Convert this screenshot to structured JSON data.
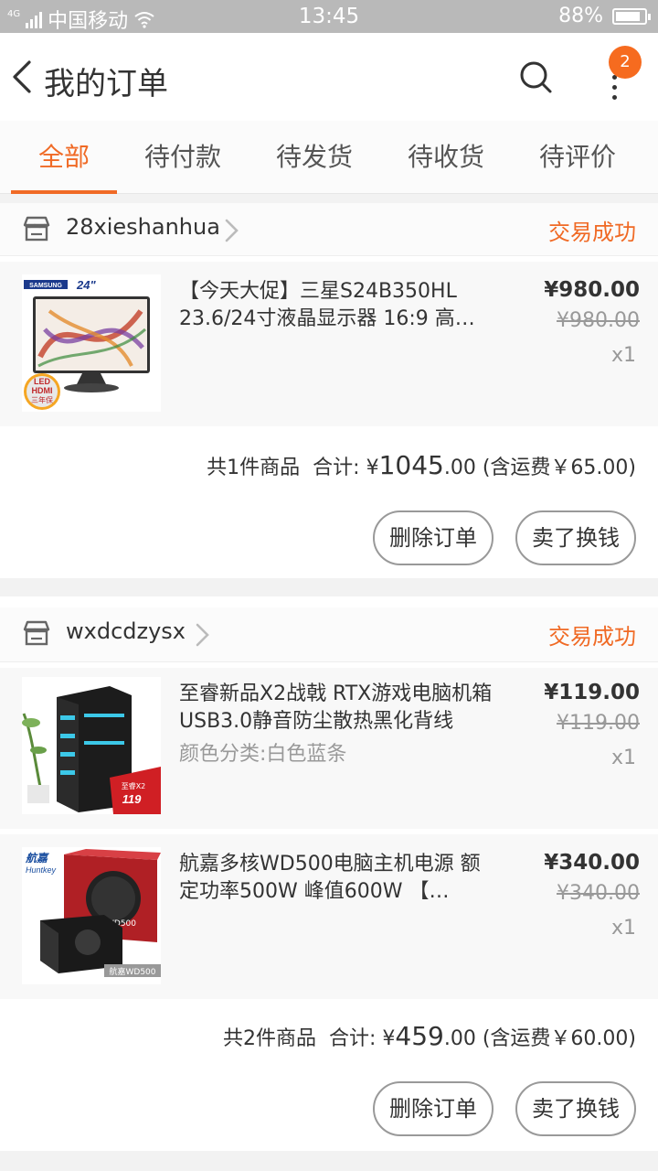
{
  "status_bar": {
    "network": "4G",
    "carrier": "中国移动",
    "time": "13:45",
    "battery": "88%",
    "battery_level": 0.88
  },
  "header": {
    "title": "我的订单",
    "badge_count": "2"
  },
  "tabs": [
    {
      "label": "全部",
      "active": true
    },
    {
      "label": "待付款",
      "active": false
    },
    {
      "label": "待发货",
      "active": false
    },
    {
      "label": "待收货",
      "active": false
    },
    {
      "label": "待评价",
      "active": false
    }
  ],
  "orders": [
    {
      "shop": "28xieshanhua",
      "status": "交易成功",
      "items": [
        {
          "title": "【今天大促】三星S24B350HL 23.6/24寸液晶显示器 16:9 高…",
          "price": "¥980.00",
          "original_price": "¥980.00",
          "qty": "x1",
          "thumb_labels": [
            "SAMSUNG",
            "24\"",
            "LED",
            "HDMI",
            "三年保"
          ]
        }
      ],
      "summary": {
        "count": "共1件商品",
        "total_label": "合计:",
        "currency": "¥",
        "total_int": "1045",
        "total_dec": ".00",
        "shipping": "(含运费￥65.00)"
      },
      "buttons": {
        "delete": "删除订单",
        "resell": "卖了换钱"
      }
    },
    {
      "shop": "wxdcdzysx",
      "status": "交易成功",
      "items": [
        {
          "title": "至睿新品X2战戟 RTX游戏电脑机箱USB3.0静音防尘散热黑化背线",
          "sku": "颜色分类:白色蓝条",
          "price": "¥119.00",
          "original_price": "¥119.00",
          "qty": "x1",
          "thumb_labels": [
            "至睿X2",
            "119"
          ]
        },
        {
          "title": "航嘉多核WD500电脑主机电源 额定功率500W 峰值600W 【…",
          "price": "¥340.00",
          "original_price": "¥340.00",
          "qty": "x1",
          "thumb_labels": [
            "航嘉",
            "Huntkey",
            "多核WD500",
            "航嘉WD500"
          ]
        }
      ],
      "summary": {
        "count": "共2件商品",
        "total_label": "合计:",
        "currency": "¥",
        "total_int": "459",
        "total_dec": ".00",
        "shipping": "(含运费￥60.00)"
      },
      "buttons": {
        "delete": "删除订单",
        "resell": "卖了换钱"
      }
    }
  ],
  "colors": {
    "accent": "#f06a25",
    "badge": "#f66b1f",
    "status_bar": "#b9b9b9"
  }
}
